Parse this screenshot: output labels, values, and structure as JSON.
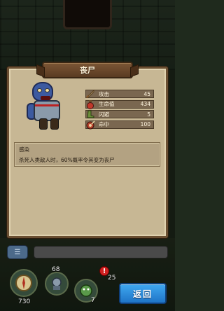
{
  "dialog": {
    "title": "丧尸"
  },
  "stats": [
    {
      "icon": "sword-icon",
      "label": "攻击",
      "value": "45",
      "color": "#c9a65a"
    },
    {
      "icon": "health-potion-icon",
      "label": "生命值",
      "value": "434",
      "color": "#c0392b"
    },
    {
      "icon": "boot-icon",
      "label": "闪避",
      "value": "5",
      "color": "#6b8e3a"
    },
    {
      "icon": "target-icon",
      "label": "命中",
      "value": "100",
      "color": "#b5422c"
    }
  ],
  "skill": {
    "name": "感染",
    "description": "杀死人类敌人时，60%概率令其变为丧尸"
  },
  "hud": {
    "chat_icon": "chat-icon",
    "slot_value_1": "68",
    "slot_value_2": "730",
    "slot_value_3": "7",
    "slot_value_4": "25",
    "alert_mark": "!"
  },
  "back_button": {
    "label": "返回",
    "color": "#2a8ad8"
  }
}
